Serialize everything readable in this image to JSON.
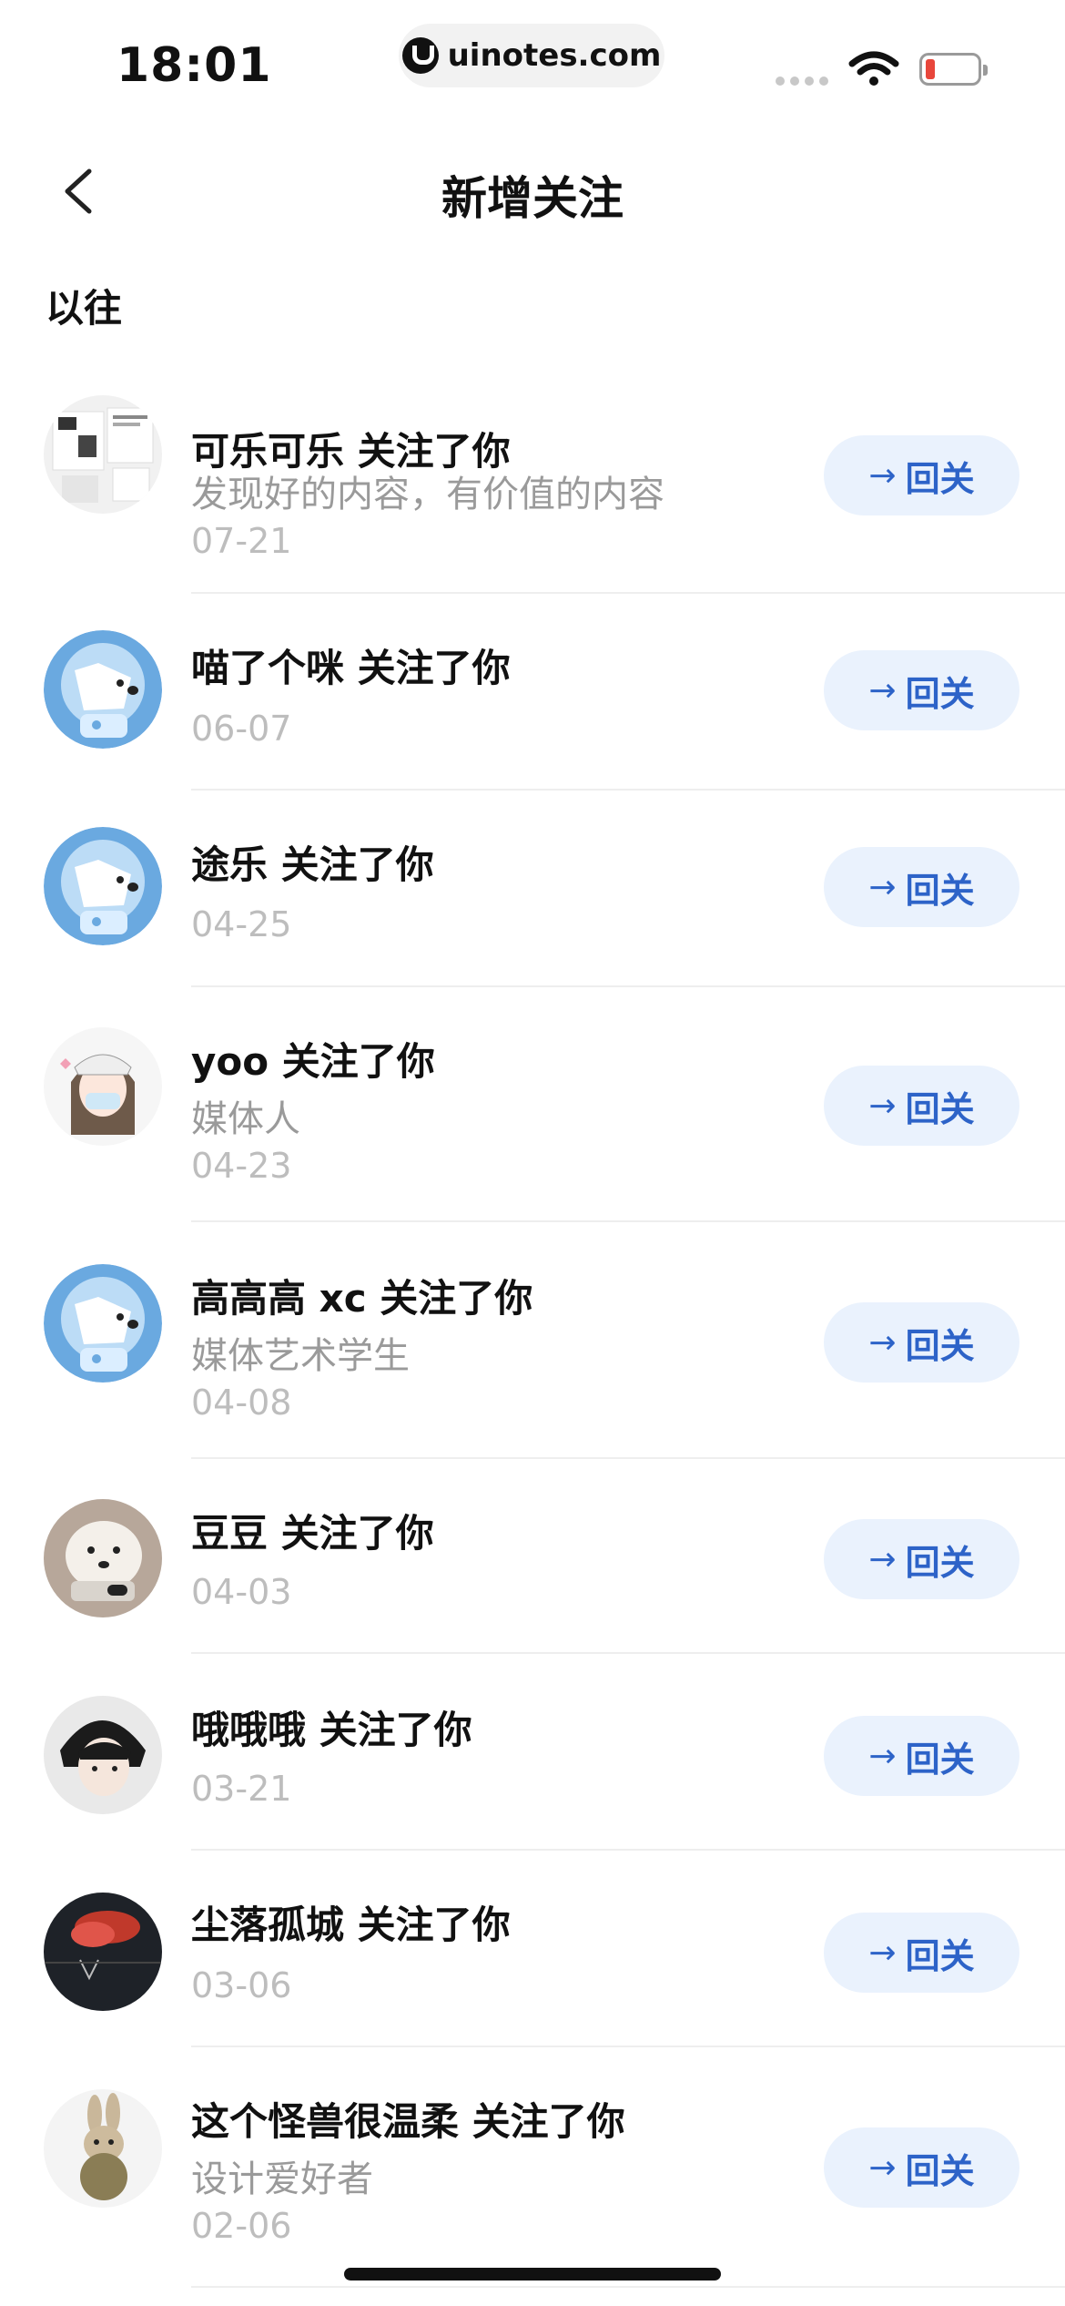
{
  "status": {
    "time": "18:01",
    "url": "uinotes.com"
  },
  "nav": {
    "title": "新增关注"
  },
  "section": {
    "label": "以往"
  },
  "follow_button": {
    "arrow": "→",
    "label": "回关"
  },
  "items": [
    {
      "name": "可乐可乐 关注了你",
      "bio": "发现好的内容，有价值的内容",
      "date": "07-21",
      "avatar": "photo-collage"
    },
    {
      "name": "喵了个咪 关注了你",
      "bio": "",
      "date": "06-07",
      "avatar": "default-astronaut-dog"
    },
    {
      "name": "途乐 关注了你",
      "bio": "",
      "date": "04-25",
      "avatar": "default-astronaut-dog"
    },
    {
      "name": "yoo 关注了你",
      "bio": "媒体人",
      "date": "04-23",
      "avatar": "cartoon-girl"
    },
    {
      "name": "高高高 xc 关注了你",
      "bio": "媒体艺术学生",
      "date": "04-08",
      "avatar": "default-astronaut-dog"
    },
    {
      "name": "豆豆 关注了你",
      "bio": "",
      "date": "04-03",
      "avatar": "white-dog-photo"
    },
    {
      "name": "哦哦哦 关注了你",
      "bio": "",
      "date": "03-21",
      "avatar": "anime-boy"
    },
    {
      "name": "尘落孤城 关注了你",
      "bio": "",
      "date": "03-06",
      "avatar": "dark-red-cloud"
    },
    {
      "name": "这个怪兽很温柔 关注了你",
      "bio": "设计爱好者",
      "date": "02-06",
      "avatar": "rabbit"
    }
  ],
  "colors": {
    "accent": "#2d63c8",
    "button_bg": "#eaf2fd",
    "secondary": "#9a9a9a",
    "date": "#bdbdbd"
  }
}
